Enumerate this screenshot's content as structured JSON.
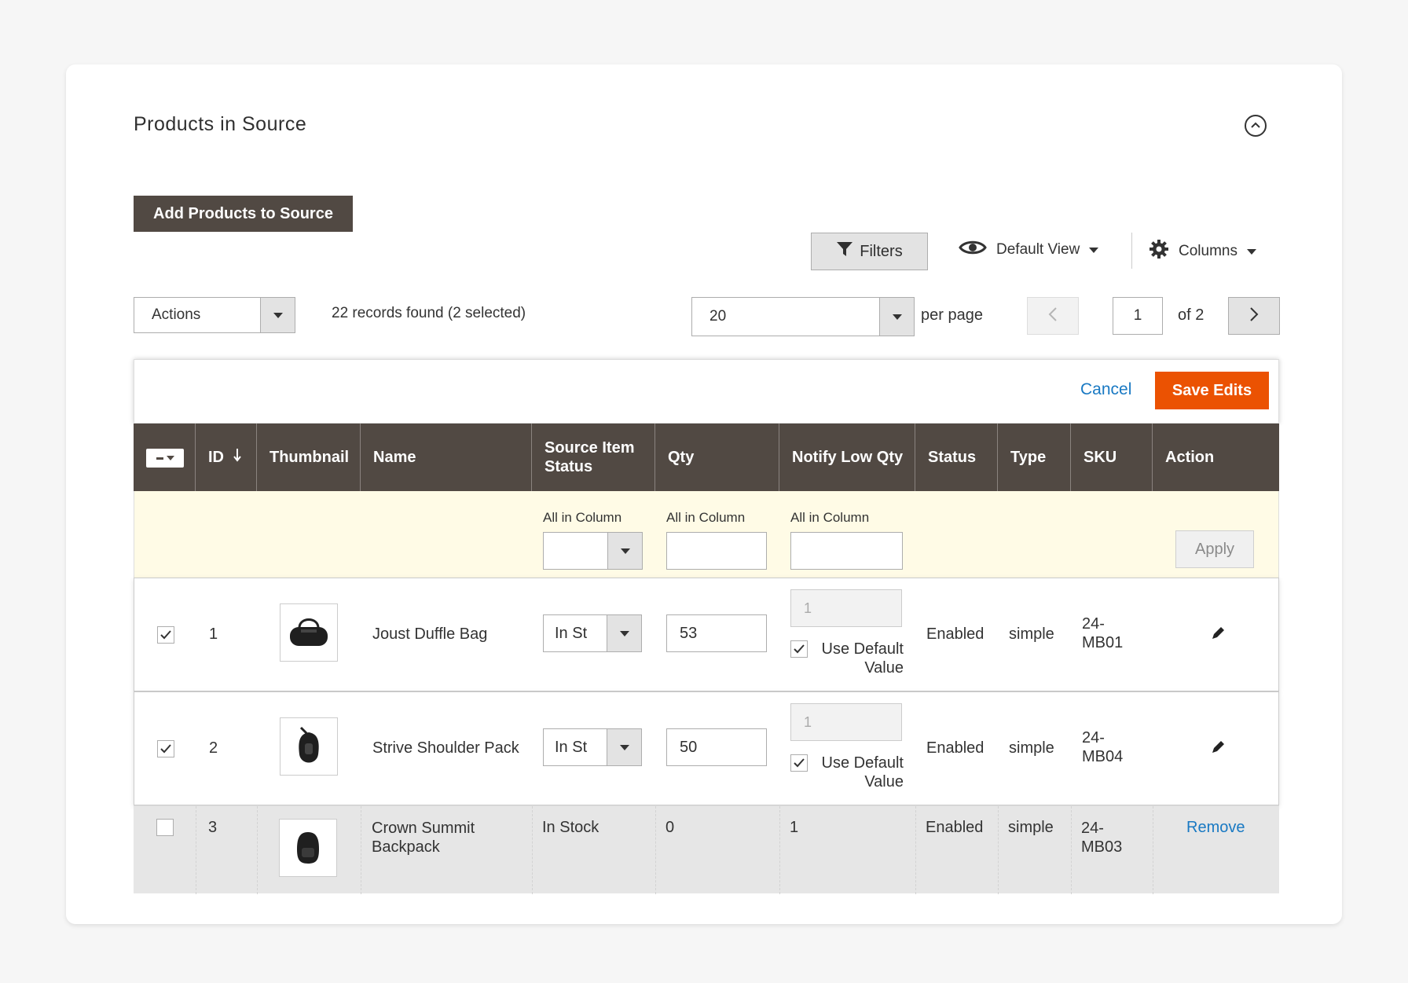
{
  "section": {
    "title": "Products in Source"
  },
  "toolbar": {
    "add_button": "Add Products to Source",
    "filters_label": "Filters",
    "view_label": "Default View",
    "columns_label": "Columns",
    "actions_label": "Actions",
    "records_text": "22 records found (2 selected)",
    "per_page_value": "20",
    "per_page_label": "per page",
    "page_current": "1",
    "page_of": "of 2"
  },
  "edit_bar": {
    "cancel": "Cancel",
    "save": "Save Edits"
  },
  "columns": [
    "ID",
    "Thumbnail",
    "Name",
    "Source Item Status",
    "Qty",
    "Notify Low Qty",
    "Status",
    "Type",
    "SKU",
    "Action"
  ],
  "apply_row": {
    "all_in_column": "All in Column",
    "apply_button": "Apply"
  },
  "rows": [
    {
      "checked": true,
      "id": "1",
      "name": "Joust Duffle Bag",
      "source_status": "In St",
      "qty": "53",
      "notify_qty": "1",
      "use_default": "Use Default",
      "use_default_2": "Value",
      "status": "Enabled",
      "type": "simple",
      "sku_1": "24-",
      "sku_2": "MB01"
    },
    {
      "checked": true,
      "id": "2",
      "name": "Strive Shoulder Pack",
      "source_status": "In St",
      "qty": "50",
      "notify_qty": "1",
      "use_default": "Use Default",
      "use_default_2": "Value",
      "status": "Enabled",
      "type": "simple",
      "sku_1": "24-",
      "sku_2": "MB04"
    },
    {
      "checked": false,
      "id": "3",
      "name_1": "Crown Summit",
      "name_2": "Backpack",
      "source_status": "In Stock",
      "qty": "0",
      "notify_qty": "1",
      "status": "Enabled",
      "type": "simple",
      "sku_1": "24-",
      "sku_2": "MB03",
      "action": "Remove"
    }
  ],
  "colors": {
    "header_bg": "#514943",
    "primary": "#eb5202",
    "link": "#1979c3",
    "apply_row_bg": "#fffbe6"
  }
}
